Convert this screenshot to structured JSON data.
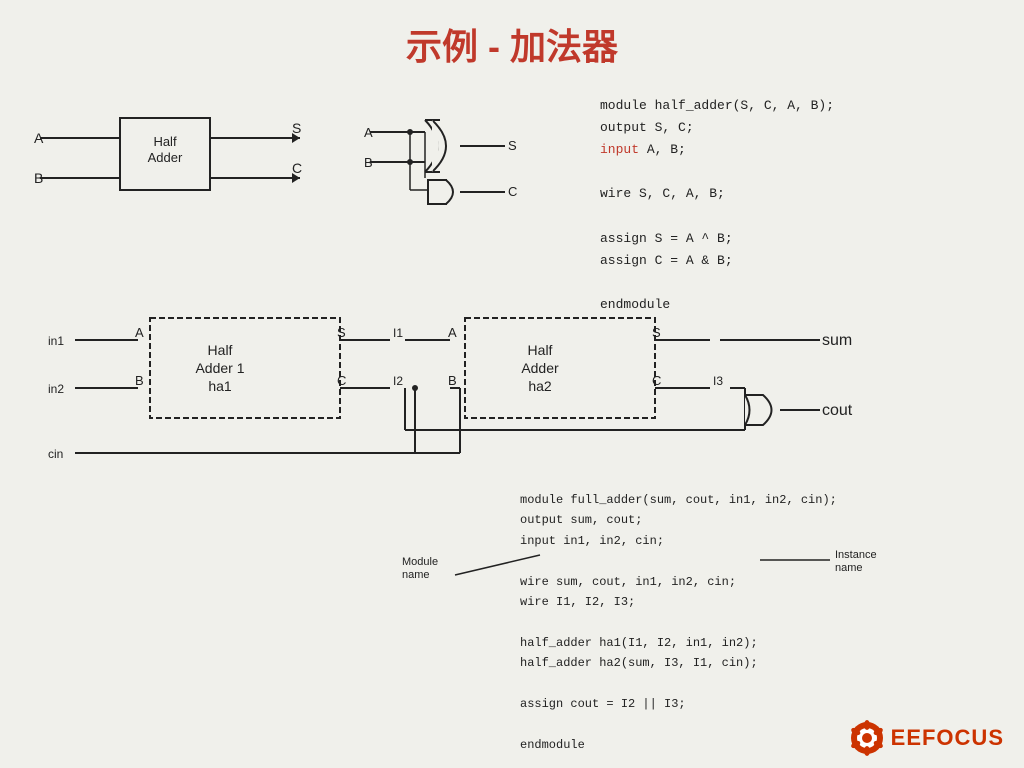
{
  "title": "示例 - 加法器",
  "top_diagram": {
    "ha_label": "Half\nAdder",
    "input_a": "A",
    "input_b": "B",
    "output_s": "S",
    "output_c": "C"
  },
  "code_top": {
    "lines": [
      "module half_adder(S, C, A, B);",
      "output S, C;",
      "input A, B;",
      "",
      "wire S, C, A, B;",
      "",
      "assign S = A ^ B;",
      "assign C = A & B;",
      "",
      "endmodule"
    ]
  },
  "full_adder_diagram": {
    "in1": "in1",
    "in2": "in2",
    "cin": "cin",
    "ha1_label": "Half\nAdder 1\nha1",
    "ha2_label": "Half\nAdder\nha2",
    "port_a": "A",
    "port_b": "B",
    "port_s": "S",
    "port_c": "C",
    "wire_I1": "I1",
    "wire_I2": "I2",
    "wire_I3": "I3",
    "sum_label": "sum",
    "cout_label": "cout"
  },
  "code_bottom": {
    "lines": [
      "module full_adder(sum, cout, in1, in2, cin);",
      "output sum, cout;",
      "input in1, in2, cin;",
      "",
      "wire sum, cout, in1, in2, cin;",
      "wire I1, I2, I3;",
      "",
      "half_adder ha1(I1, I2, in1, in2);",
      "half_adder ha2(sum, I3, I1, cin);",
      "",
      "assign cout = I2 || I3;",
      "",
      "endmodule"
    ]
  },
  "module_name_label": "Module\nname",
  "instance_name_label": "Instance\nname",
  "logo": {
    "text": "EEFOCUS"
  }
}
